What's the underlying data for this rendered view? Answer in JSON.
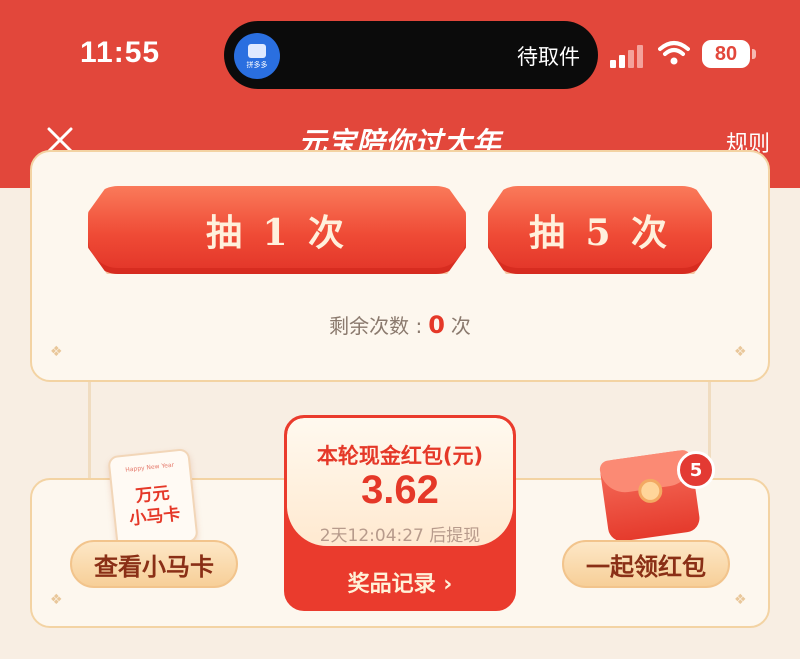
{
  "status_bar": {
    "time": "11:55",
    "island_app_label": "拼多多",
    "island_text": "待取件",
    "battery": "80"
  },
  "header": {
    "title": "元宝陪你过大年",
    "rules_label": "规则",
    "close_icon": "close-icon"
  },
  "draw": {
    "once_label": "抽 1 次",
    "five_label": "抽 5 次",
    "remaining_prefix": "剩余次数 :",
    "remaining_count": "0",
    "remaining_suffix": "次"
  },
  "cash_card": {
    "title": "本轮现金红包(元)",
    "amount": "3.62",
    "timer": "2天12:04:27 后提现",
    "record_label": "奖品记录 ›"
  },
  "left_feature": {
    "card_tiny_text": "Happy New Year",
    "card_text": "万元\n小马卡",
    "button_label": "查看小马卡"
  },
  "right_feature": {
    "badge": "5",
    "button_label": "一起领红包"
  },
  "colors": {
    "header_red": "#e2473b",
    "accent_red": "#e53828",
    "gold_border": "#f3d3a3",
    "panel_bg": "#fdf7ee"
  }
}
